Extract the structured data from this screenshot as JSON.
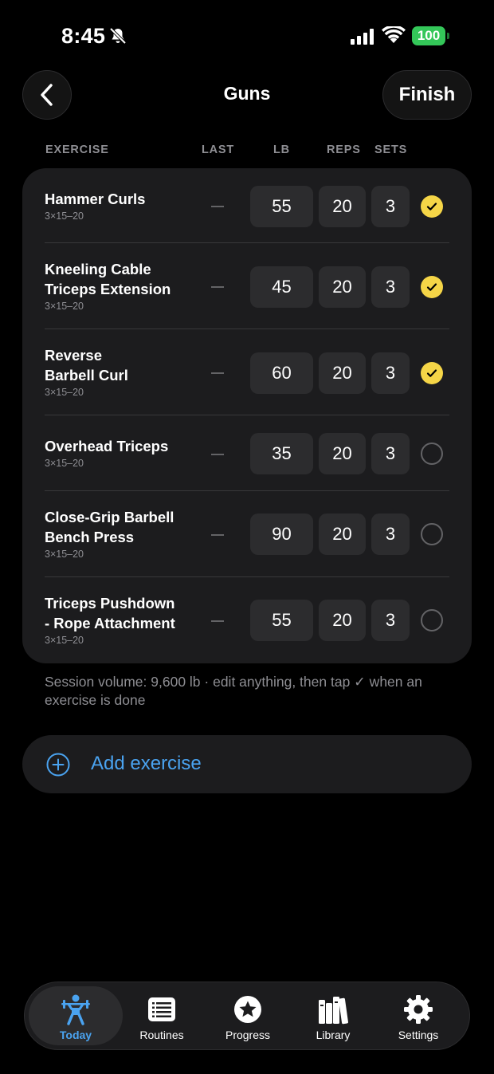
{
  "status": {
    "time": "8:45",
    "battery": "100"
  },
  "header": {
    "title": "Guns",
    "finish_label": "Finish"
  },
  "columns": {
    "exercise": "EXERCISE",
    "last": "LAST",
    "lb": "LB",
    "reps": "REPS",
    "sets": "SETS"
  },
  "exercises": [
    {
      "name_lines": [
        "Hammer Curls"
      ],
      "scheme": "3×15–20",
      "lb": "55",
      "reps": "20",
      "sets": "3",
      "done": true
    },
    {
      "name_lines": [
        "Kneeling Cable",
        "Triceps Extension"
      ],
      "scheme": "3×15–20",
      "lb": "45",
      "reps": "20",
      "sets": "3",
      "done": true
    },
    {
      "name_lines": [
        "Reverse",
        "Barbell Curl"
      ],
      "scheme": "3×15–20",
      "lb": "60",
      "reps": "20",
      "sets": "3",
      "done": true
    },
    {
      "name_lines": [
        "Overhead Triceps"
      ],
      "scheme": "3×15–20",
      "lb": "35",
      "reps": "20",
      "sets": "3",
      "done": false
    },
    {
      "name_lines": [
        "Close-Grip Barbell",
        "Bench Press"
      ],
      "scheme": "3×15–20",
      "lb": "90",
      "reps": "20",
      "sets": "3",
      "done": false
    },
    {
      "name_lines": [
        "Triceps Pushdown",
        "- Rope Attachment"
      ],
      "scheme": "3×15–20",
      "lb": "55",
      "reps": "20",
      "sets": "3",
      "done": false
    }
  ],
  "note": "Session volume: 9,600 lb · edit anything, then tap ✓ when an exercise is done",
  "add_exercise_label": "Add exercise",
  "tabs": [
    {
      "label": "Today",
      "icon": "weightlifter-icon",
      "active": true
    },
    {
      "label": "Routines",
      "icon": "list-icon",
      "active": false
    },
    {
      "label": "Progress",
      "icon": "star-icon",
      "active": false
    },
    {
      "label": "Library",
      "icon": "books-icon",
      "active": false
    },
    {
      "label": "Settings",
      "icon": "gear-icon",
      "active": false
    }
  ],
  "colors": {
    "accent": "#4aa3f0",
    "check": "#f5d547",
    "battery": "#34c759"
  }
}
